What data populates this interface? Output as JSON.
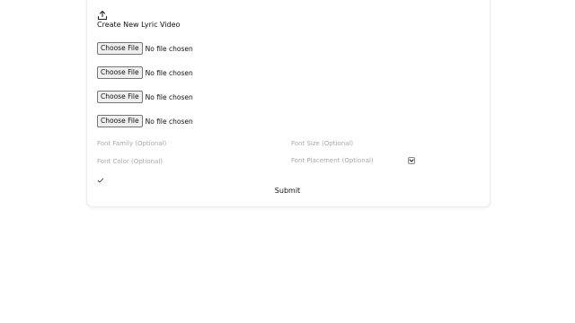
{
  "form": {
    "title": "Create New Lyric Video",
    "upload_icon": "upload-icon",
    "file_inputs": [
      {
        "button_label": "Choose File",
        "status": "No file chosen"
      },
      {
        "button_label": "Choose File",
        "status": "No file chosen"
      },
      {
        "button_label": "Choose File",
        "status": "No file chosen"
      },
      {
        "button_label": "Choose File",
        "status": "No file chosen"
      }
    ],
    "font_family": {
      "placeholder": "Font Family (Optional)",
      "value": ""
    },
    "font_size": {
      "placeholder": "Font Size (Optional)",
      "value": ""
    },
    "font_color": {
      "placeholder": "Font Color (Optional)",
      "value": ""
    },
    "font_placement": {
      "selected": "Font Placement (Optional)",
      "icon": "chevron-down-icon"
    },
    "checkbox_icon": "checkmark-icon",
    "submit_label": "Submit"
  }
}
